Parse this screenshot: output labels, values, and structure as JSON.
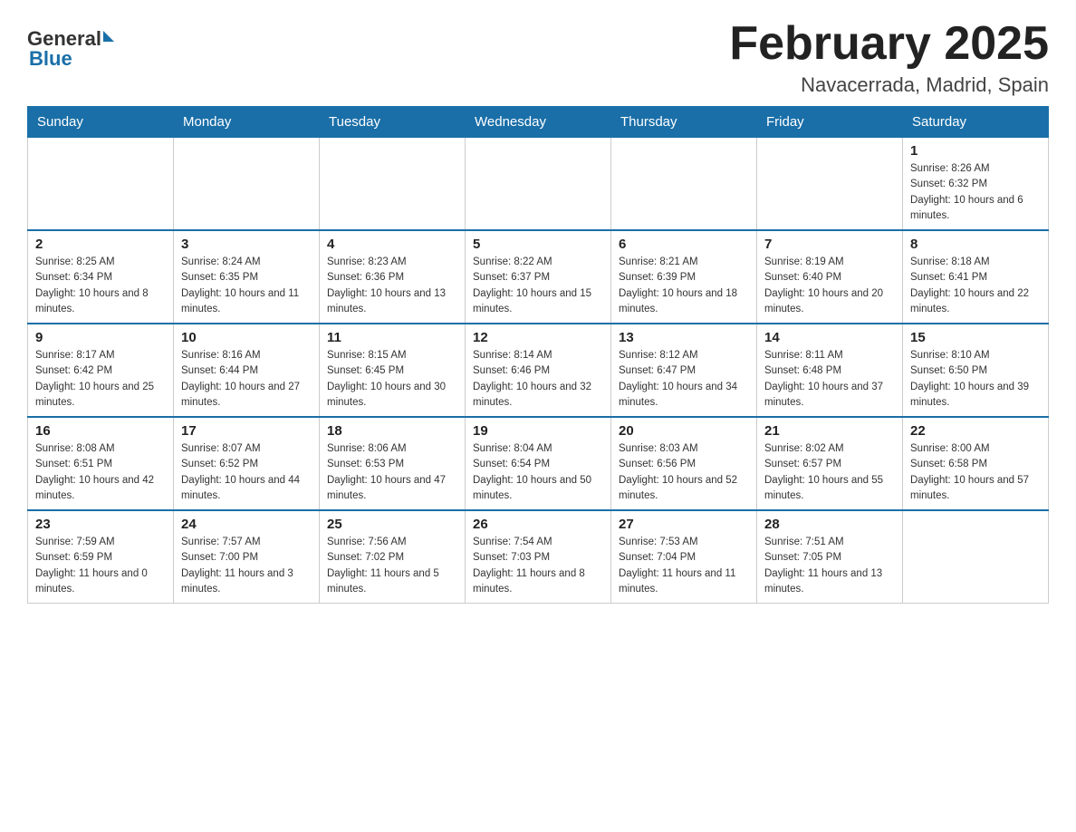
{
  "header": {
    "logo_general": "General",
    "logo_blue": "Blue",
    "title": "February 2025",
    "subtitle": "Navacerrada, Madrid, Spain"
  },
  "days_of_week": [
    "Sunday",
    "Monday",
    "Tuesday",
    "Wednesday",
    "Thursday",
    "Friday",
    "Saturday"
  ],
  "weeks": [
    [
      {
        "num": "",
        "info": ""
      },
      {
        "num": "",
        "info": ""
      },
      {
        "num": "",
        "info": ""
      },
      {
        "num": "",
        "info": ""
      },
      {
        "num": "",
        "info": ""
      },
      {
        "num": "",
        "info": ""
      },
      {
        "num": "1",
        "info": "Sunrise: 8:26 AM\nSunset: 6:32 PM\nDaylight: 10 hours and 6 minutes."
      }
    ],
    [
      {
        "num": "2",
        "info": "Sunrise: 8:25 AM\nSunset: 6:34 PM\nDaylight: 10 hours and 8 minutes."
      },
      {
        "num": "3",
        "info": "Sunrise: 8:24 AM\nSunset: 6:35 PM\nDaylight: 10 hours and 11 minutes."
      },
      {
        "num": "4",
        "info": "Sunrise: 8:23 AM\nSunset: 6:36 PM\nDaylight: 10 hours and 13 minutes."
      },
      {
        "num": "5",
        "info": "Sunrise: 8:22 AM\nSunset: 6:37 PM\nDaylight: 10 hours and 15 minutes."
      },
      {
        "num": "6",
        "info": "Sunrise: 8:21 AM\nSunset: 6:39 PM\nDaylight: 10 hours and 18 minutes."
      },
      {
        "num": "7",
        "info": "Sunrise: 8:19 AM\nSunset: 6:40 PM\nDaylight: 10 hours and 20 minutes."
      },
      {
        "num": "8",
        "info": "Sunrise: 8:18 AM\nSunset: 6:41 PM\nDaylight: 10 hours and 22 minutes."
      }
    ],
    [
      {
        "num": "9",
        "info": "Sunrise: 8:17 AM\nSunset: 6:42 PM\nDaylight: 10 hours and 25 minutes."
      },
      {
        "num": "10",
        "info": "Sunrise: 8:16 AM\nSunset: 6:44 PM\nDaylight: 10 hours and 27 minutes."
      },
      {
        "num": "11",
        "info": "Sunrise: 8:15 AM\nSunset: 6:45 PM\nDaylight: 10 hours and 30 minutes."
      },
      {
        "num": "12",
        "info": "Sunrise: 8:14 AM\nSunset: 6:46 PM\nDaylight: 10 hours and 32 minutes."
      },
      {
        "num": "13",
        "info": "Sunrise: 8:12 AM\nSunset: 6:47 PM\nDaylight: 10 hours and 34 minutes."
      },
      {
        "num": "14",
        "info": "Sunrise: 8:11 AM\nSunset: 6:48 PM\nDaylight: 10 hours and 37 minutes."
      },
      {
        "num": "15",
        "info": "Sunrise: 8:10 AM\nSunset: 6:50 PM\nDaylight: 10 hours and 39 minutes."
      }
    ],
    [
      {
        "num": "16",
        "info": "Sunrise: 8:08 AM\nSunset: 6:51 PM\nDaylight: 10 hours and 42 minutes."
      },
      {
        "num": "17",
        "info": "Sunrise: 8:07 AM\nSunset: 6:52 PM\nDaylight: 10 hours and 44 minutes."
      },
      {
        "num": "18",
        "info": "Sunrise: 8:06 AM\nSunset: 6:53 PM\nDaylight: 10 hours and 47 minutes."
      },
      {
        "num": "19",
        "info": "Sunrise: 8:04 AM\nSunset: 6:54 PM\nDaylight: 10 hours and 50 minutes."
      },
      {
        "num": "20",
        "info": "Sunrise: 8:03 AM\nSunset: 6:56 PM\nDaylight: 10 hours and 52 minutes."
      },
      {
        "num": "21",
        "info": "Sunrise: 8:02 AM\nSunset: 6:57 PM\nDaylight: 10 hours and 55 minutes."
      },
      {
        "num": "22",
        "info": "Sunrise: 8:00 AM\nSunset: 6:58 PM\nDaylight: 10 hours and 57 minutes."
      }
    ],
    [
      {
        "num": "23",
        "info": "Sunrise: 7:59 AM\nSunset: 6:59 PM\nDaylight: 11 hours and 0 minutes."
      },
      {
        "num": "24",
        "info": "Sunrise: 7:57 AM\nSunset: 7:00 PM\nDaylight: 11 hours and 3 minutes."
      },
      {
        "num": "25",
        "info": "Sunrise: 7:56 AM\nSunset: 7:02 PM\nDaylight: 11 hours and 5 minutes."
      },
      {
        "num": "26",
        "info": "Sunrise: 7:54 AM\nSunset: 7:03 PM\nDaylight: 11 hours and 8 minutes."
      },
      {
        "num": "27",
        "info": "Sunrise: 7:53 AM\nSunset: 7:04 PM\nDaylight: 11 hours and 11 minutes."
      },
      {
        "num": "28",
        "info": "Sunrise: 7:51 AM\nSunset: 7:05 PM\nDaylight: 11 hours and 13 minutes."
      },
      {
        "num": "",
        "info": ""
      }
    ]
  ]
}
